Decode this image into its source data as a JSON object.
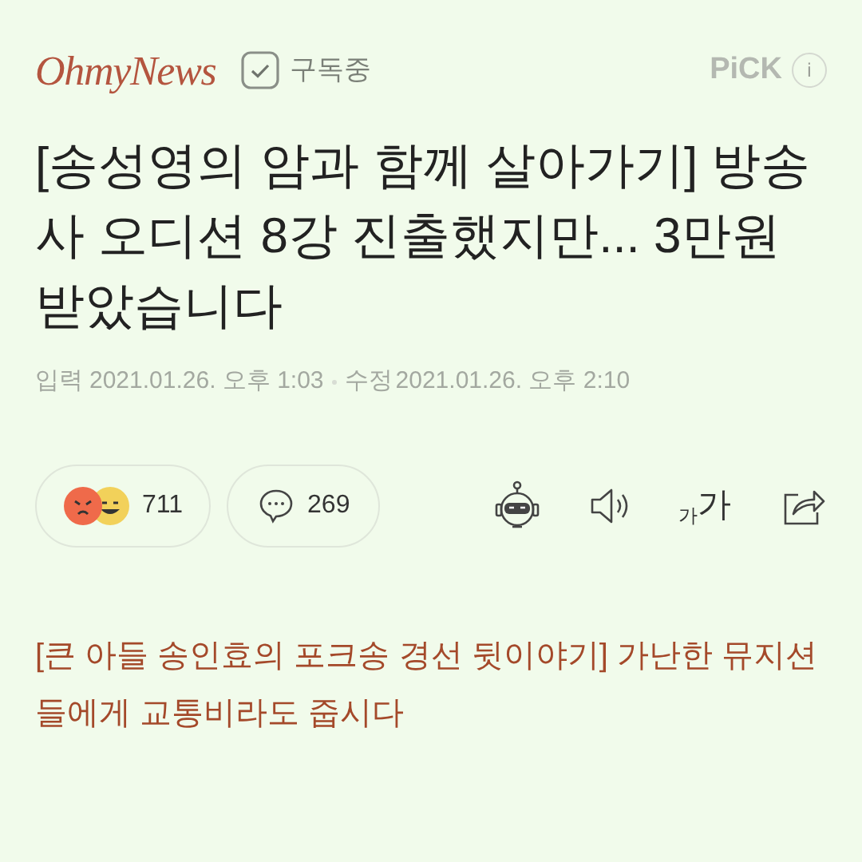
{
  "header": {
    "logo": "OhmyNews",
    "subscribe": {
      "label": "구독중",
      "subscribed": true
    },
    "pick": "PiCK",
    "info": "i"
  },
  "headline": "[송성영의 암과 함께 살아가기] 방송사 오디션 8강 진출했지만... 3만원 받았습니다",
  "dates": {
    "input_label": "입력",
    "input": "2021.01.26. 오후 1:03",
    "edit_label": "수정",
    "edit": "2021.01.26. 오후 2:10"
  },
  "actions": {
    "reactions": "711",
    "comments": "269",
    "font_size": [
      "가",
      "가"
    ]
  },
  "related": "[큰 아들 송인효의 포크송 경선 뒷이야기] 가난한 뮤지션들에게 교통비라도 줍시다"
}
